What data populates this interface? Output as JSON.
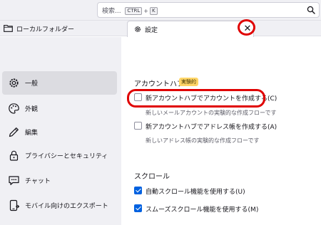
{
  "search": {
    "placeholder": "検索...",
    "shortcut_key1": "CTRL",
    "shortcut_plus": "+",
    "shortcut_key2": "K"
  },
  "folder": {
    "label": "ローカルフォルダー"
  },
  "tab": {
    "label": "設定",
    "close": "✕"
  },
  "sidebar": {
    "items": [
      {
        "label": "一般",
        "icon": "gear-icon",
        "selected": true
      },
      {
        "label": "外観",
        "icon": "palette-icon",
        "selected": false
      },
      {
        "label": "編集",
        "icon": "pencil-icon",
        "selected": false
      },
      {
        "label": "プライバシーとセキュリティ",
        "icon": "lock-icon",
        "selected": false
      },
      {
        "label": "チャット",
        "icon": "chat-icon",
        "selected": false
      },
      {
        "label": "モバイル向けのエクスポート",
        "icon": "mobile-export-icon",
        "selected": false
      }
    ]
  },
  "main": {
    "account_hub": {
      "title": "アカウントハブ",
      "badge": "実験的",
      "options": [
        {
          "label": "新アカウントハブでアカウントを作成する(C)",
          "checked": false,
          "description": "新しいメールアカウントの実験的な作成フローです"
        },
        {
          "label": "新アカウントハブでアドレス帳を作成する(A)",
          "checked": false,
          "description": "新しいアドレス帳の実験的な作成フローです"
        }
      ]
    },
    "scroll": {
      "title": "スクロール",
      "options": [
        {
          "label": "自動スクロール機能を使用する(U)",
          "checked": true
        },
        {
          "label": "スムーズスクロール機能を使用する(M)",
          "checked": true
        }
      ]
    }
  },
  "colors": {
    "accent": "#0061e0",
    "highlight": "#e00000",
    "badge": "#ffd567"
  }
}
